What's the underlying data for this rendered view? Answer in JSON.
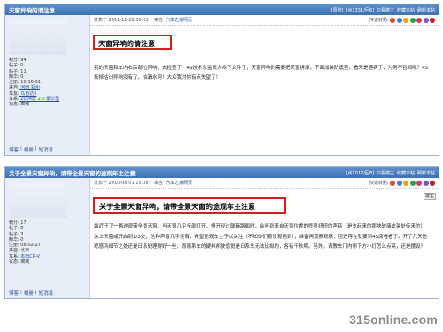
{
  "post1": {
    "title": "天窗异响的请注意",
    "title_links": [
      "[原创]",
      "[点1331/回6]",
      "只看楼主",
      "收藏本帖",
      "刷新本帖"
    ],
    "username": "",
    "stats": [
      {
        "label": "积分:",
        "value": "94"
      },
      {
        "label": "帖子:",
        "value": "0"
      },
      {
        "label": "帖子:",
        "value": "11"
      },
      {
        "label": "精华:",
        "value": "0"
      },
      {
        "label": "注册:",
        "value": "10-10-31"
      },
      {
        "label": "来自:",
        "value": "河南 郑州",
        "link": true
      },
      {
        "label": "车友:",
        "value": "马自达6",
        "link": true
      },
      {
        "label": "车系:",
        "value": "2004款 2.0 豪华型",
        "link": true
      },
      {
        "label": "状态:",
        "value": "离线"
      }
    ],
    "actions": [
      "博客",
      "相册",
      "短消息"
    ],
    "meta": {
      "posted": "发表于 2011-11-28 00:03",
      "from_label": "| 来自",
      "from": "汽车之家网页",
      "share_label": "快速转贴:"
    },
    "heading": "天窗异响的请注意",
    "content": "我的天窗和车内右后部位异响，去检查了，4S技术总监说大众下文件了，天窗异响的需要把天窗拆掉，下面加装防震垫，看来是通病了，为何不召回呢？4S拆掉估计异响没有了，怕漏水呵！大众我对你有点失望了！"
  },
  "post2": {
    "title": "关于全景天窗异响，请带全景天窗的途观车主注意",
    "title_links": [
      "[点1017/回8]",
      "只看楼主",
      "收藏本帖",
      "刷新本帖"
    ],
    "username": "",
    "stats": [
      {
        "label": "积分:",
        "value": "17"
      },
      {
        "label": "帖子:",
        "value": "0"
      },
      {
        "label": "帖子:",
        "value": "3"
      },
      {
        "label": "精华:",
        "value": "0"
      },
      {
        "label": "注册:",
        "value": "08-02-27"
      },
      {
        "label": "来自:",
        "value": "北京"
      },
      {
        "label": "车系:",
        "value": "本田CR-V",
        "link": true
      },
      {
        "label": "状态:",
        "value": "离线"
      }
    ],
    "actions": [
      "博客",
      "相册",
      "短消息"
    ],
    "meta": {
      "posted": "发表于 2010-08-01 15:38",
      "from_label": "| 来自",
      "from": "汽车之家网页",
      "share_label": "快速转贴:"
    },
    "scroll_label": "楼主",
    "heading": "关于全景天窗异响，请带全景天窗的途观车主注意",
    "content": "最近开了一辆途观带全景天窗，当天窗几乎全部打开，慢开经过颠簸路面时，会听到来自天窗位置的咚咚扭扭的声音（是支起来的那块玻璃支架处传来的），关上天窗或开启到1/3处，这种声音几乎没有，希望途观车主予以关注（不知你们有没有遇到），准备再观察观察，否还存在就要到4S店看看了。开了几天途观感到细节之处还是日系处理得好一些，而德系车的硬邦邦驶感觉是日系车无法比拟的，各有千秋啊。另外，请教车门内侧下方小灯怎么点亮，还是摆设？"
  },
  "watermark": "315online.com",
  "colors": {
    "titlebar": "#4f80c0",
    "sidebar": "#e8eef7",
    "highlight_border": "#d21f1f",
    "link": "#2850a0"
  }
}
